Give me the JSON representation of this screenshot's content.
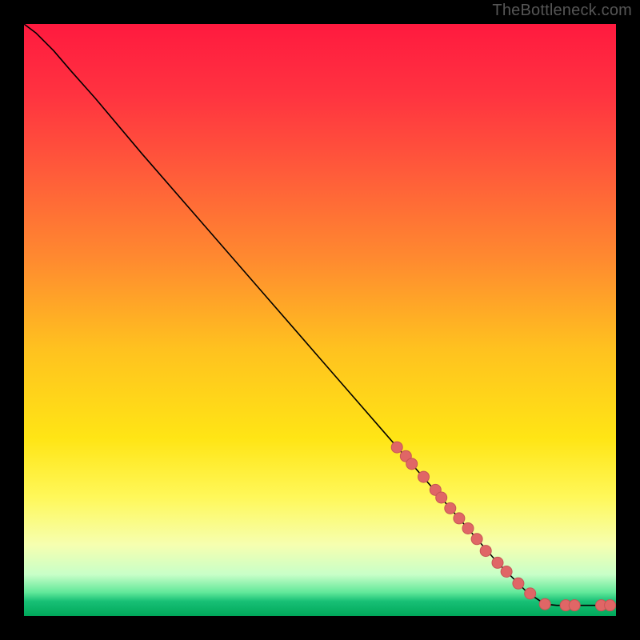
{
  "attribution": "TheBottleneck.com",
  "chart_data": {
    "type": "line",
    "title": "",
    "xlabel": "",
    "ylabel": "",
    "xlim": [
      0,
      100
    ],
    "ylim": [
      0,
      100
    ],
    "background_gradient": {
      "stops": [
        {
          "offset": 0.0,
          "color": "#ff1a3f"
        },
        {
          "offset": 0.12,
          "color": "#ff3340"
        },
        {
          "offset": 0.25,
          "color": "#ff5b3a"
        },
        {
          "offset": 0.4,
          "color": "#ff8b2f"
        },
        {
          "offset": 0.55,
          "color": "#ffc21f"
        },
        {
          "offset": 0.7,
          "color": "#ffe515"
        },
        {
          "offset": 0.8,
          "color": "#fff85a"
        },
        {
          "offset": 0.88,
          "color": "#f6ffb0"
        },
        {
          "offset": 0.93,
          "color": "#c8ffc8"
        },
        {
          "offset": 0.96,
          "color": "#62e89a"
        },
        {
          "offset": 0.975,
          "color": "#18c076"
        },
        {
          "offset": 1.0,
          "color": "#00a85a"
        }
      ]
    },
    "series": [
      {
        "name": "curve",
        "type": "line",
        "stroke": "#000000",
        "stroke_width": 1.6,
        "points": [
          {
            "x": 0.0,
            "y": 100.0
          },
          {
            "x": 2.0,
            "y": 98.5
          },
          {
            "x": 5.0,
            "y": 95.5
          },
          {
            "x": 8.0,
            "y": 92.0
          },
          {
            "x": 12.0,
            "y": 87.5
          },
          {
            "x": 20.0,
            "y": 78.0
          },
          {
            "x": 30.0,
            "y": 66.5
          },
          {
            "x": 40.0,
            "y": 55.0
          },
          {
            "x": 50.0,
            "y": 43.5
          },
          {
            "x": 60.0,
            "y": 32.0
          },
          {
            "x": 70.0,
            "y": 20.5
          },
          {
            "x": 80.0,
            "y": 9.0
          },
          {
            "x": 85.0,
            "y": 4.0
          },
          {
            "x": 88.0,
            "y": 2.0
          },
          {
            "x": 90.0,
            "y": 1.8
          },
          {
            "x": 95.0,
            "y": 1.8
          },
          {
            "x": 100.0,
            "y": 1.8
          }
        ]
      },
      {
        "name": "markers",
        "type": "scatter",
        "marker_fill": "#e06666",
        "marker_stroke": "#c65555",
        "marker_radius": 7,
        "points": [
          {
            "x": 63.0,
            "y": 28.5
          },
          {
            "x": 64.5,
            "y": 27.0
          },
          {
            "x": 65.5,
            "y": 25.7
          },
          {
            "x": 67.5,
            "y": 23.5
          },
          {
            "x": 69.5,
            "y": 21.3
          },
          {
            "x": 70.5,
            "y": 20.0
          },
          {
            "x": 72.0,
            "y": 18.2
          },
          {
            "x": 73.5,
            "y": 16.5
          },
          {
            "x": 75.0,
            "y": 14.8
          },
          {
            "x": 76.5,
            "y": 13.0
          },
          {
            "x": 78.0,
            "y": 11.0
          },
          {
            "x": 80.0,
            "y": 9.0
          },
          {
            "x": 81.5,
            "y": 7.5
          },
          {
            "x": 83.5,
            "y": 5.5
          },
          {
            "x": 85.5,
            "y": 3.8
          },
          {
            "x": 88.0,
            "y": 2.0
          },
          {
            "x": 91.5,
            "y": 1.8
          },
          {
            "x": 93.0,
            "y": 1.8
          },
          {
            "x": 97.5,
            "y": 1.8
          },
          {
            "x": 99.0,
            "y": 1.8
          }
        ]
      }
    ]
  }
}
